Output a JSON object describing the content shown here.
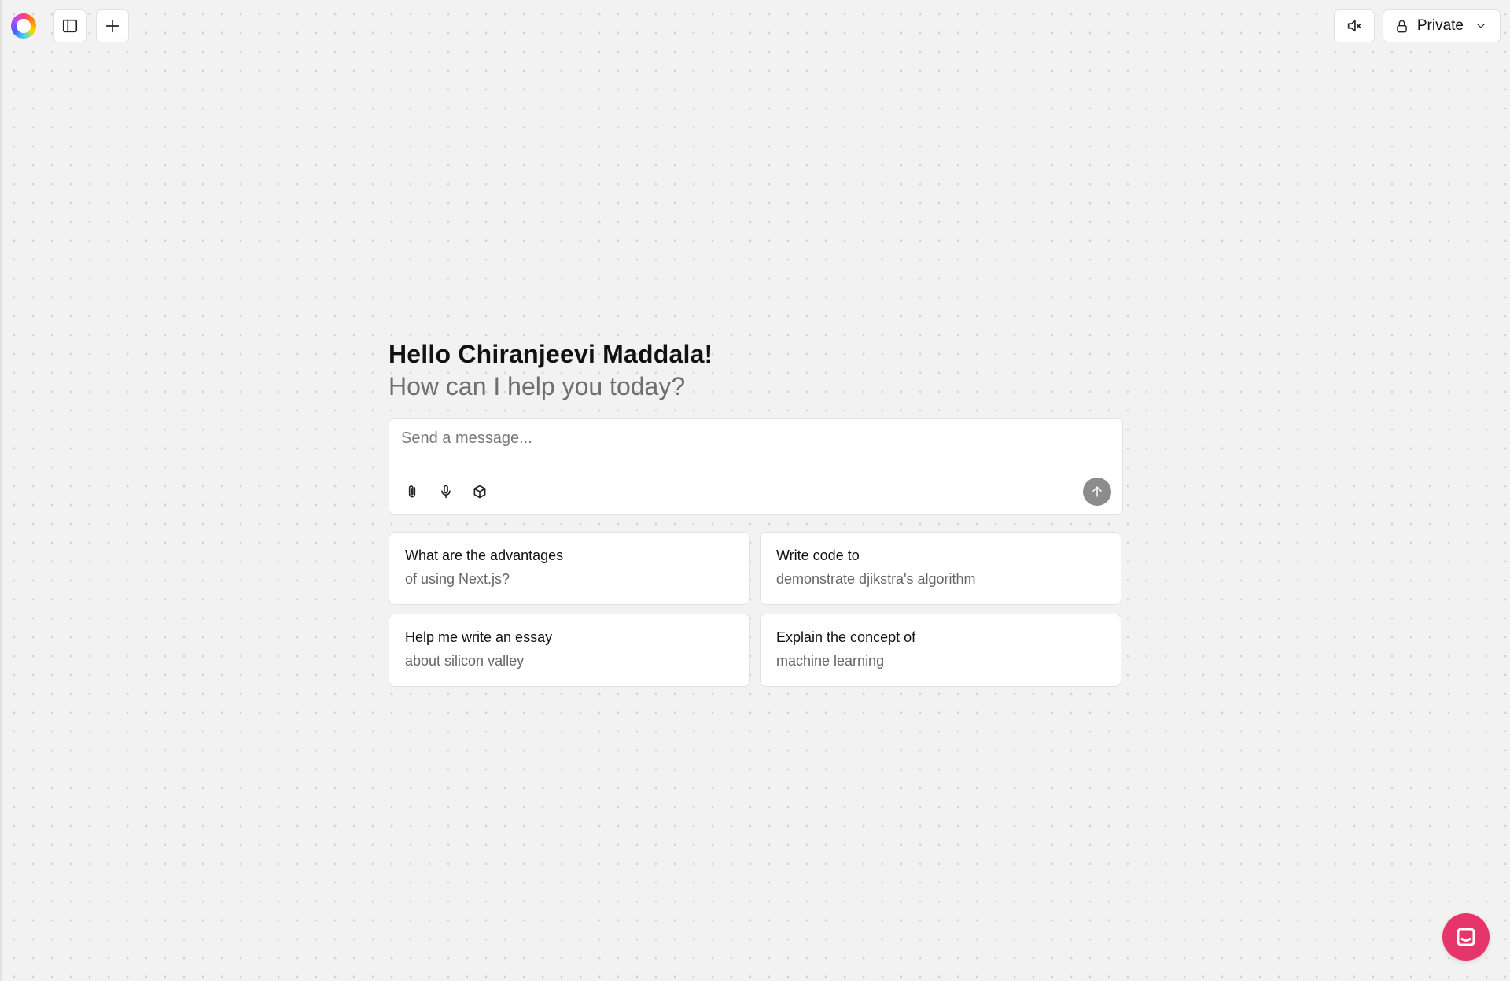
{
  "header": {
    "visibility_label": "Private",
    "icons": {
      "logo": "app-logo",
      "sidebar_toggle": "sidebar-toggle-icon",
      "new_chat": "plus-icon",
      "mute": "speaker-muted-icon",
      "lock": "lock-icon",
      "chevron": "chevron-down-icon"
    }
  },
  "main": {
    "greeting": "Hello Chiranjeevi Maddala!",
    "subgreeting": "How can I help you today?",
    "composer": {
      "placeholder": "Send a message...",
      "value": "",
      "tools": [
        "paperclip-icon",
        "microphone-icon",
        "cube-icon"
      ],
      "send_icon": "arrow-up-icon"
    },
    "suggestions": [
      {
        "title": "What are the advantages",
        "subtitle": "of using Next.js?"
      },
      {
        "title": "Write code to",
        "subtitle": "demonstrate djikstra's algorithm"
      },
      {
        "title": "Help me write an essay",
        "subtitle": "about silicon valley"
      },
      {
        "title": "Explain the concept of",
        "subtitle": "machine learning"
      }
    ]
  },
  "help_widget": {
    "icon": "chat-bubble-icon",
    "color": "#e6356a"
  },
  "colors": {
    "background": "#f2f2f2",
    "surface": "#ffffff",
    "border": "#e1e1e1",
    "muted_text": "#6f6f6f",
    "send_button": "#8c8c8c",
    "accent": "#e6356a"
  }
}
